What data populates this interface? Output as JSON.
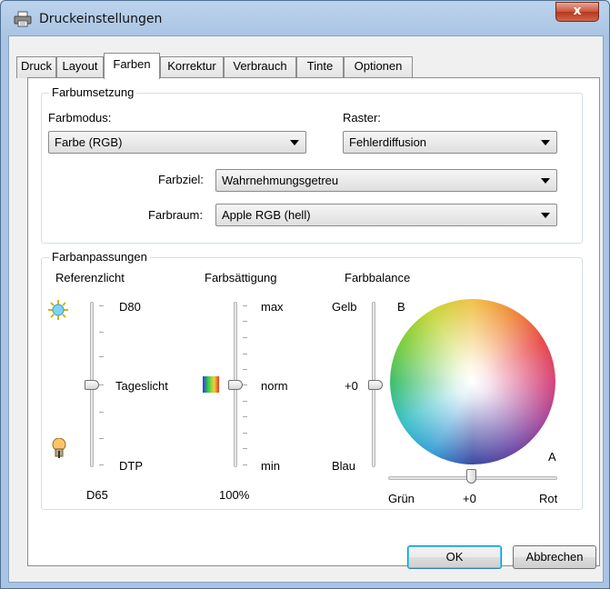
{
  "window": {
    "title": "Druckeinstellungen",
    "close_label": "x"
  },
  "tabs": [
    {
      "label": "Druck"
    },
    {
      "label": "Layout"
    },
    {
      "label": "Farben"
    },
    {
      "label": "Korrektur"
    },
    {
      "label": "Verbrauch"
    },
    {
      "label": "Tinte"
    },
    {
      "label": "Optionen"
    }
  ],
  "active_tab": "Farben",
  "farbumsetzung": {
    "title": "Farbumsetzung",
    "farbmodus_label": "Farbmodus:",
    "farbmodus_value": "Farbe (RGB)",
    "raster_label": "Raster:",
    "raster_value": "Fehlerdiffusion",
    "farbziel_label": "Farbziel:",
    "farbziel_value": "Wahrnehmungsgetreu",
    "farbraum_label": "Farbraum:",
    "farbraum_value": "Apple RGB (hell)"
  },
  "farbanpassungen": {
    "title": "Farbanpassungen",
    "referenzlicht": {
      "heading": "Referenzlicht",
      "top": "D80",
      "middle": "Tageslicht",
      "bottom": "DTP",
      "value": "D65"
    },
    "farbsaettigung": {
      "heading": "Farbsättigung",
      "top": "max",
      "middle": "norm",
      "bottom": "min",
      "value": "100%"
    },
    "farbbalance": {
      "heading": "Farbbalance",
      "top": "Gelb",
      "middle": "+0",
      "bottom": "Blau",
      "axis_b": "B",
      "axis_a": "A",
      "left": "Grün",
      "center": "+0",
      "right": "Rot"
    }
  },
  "buttons": {
    "ok": "OK",
    "cancel": "Abbrechen"
  }
}
